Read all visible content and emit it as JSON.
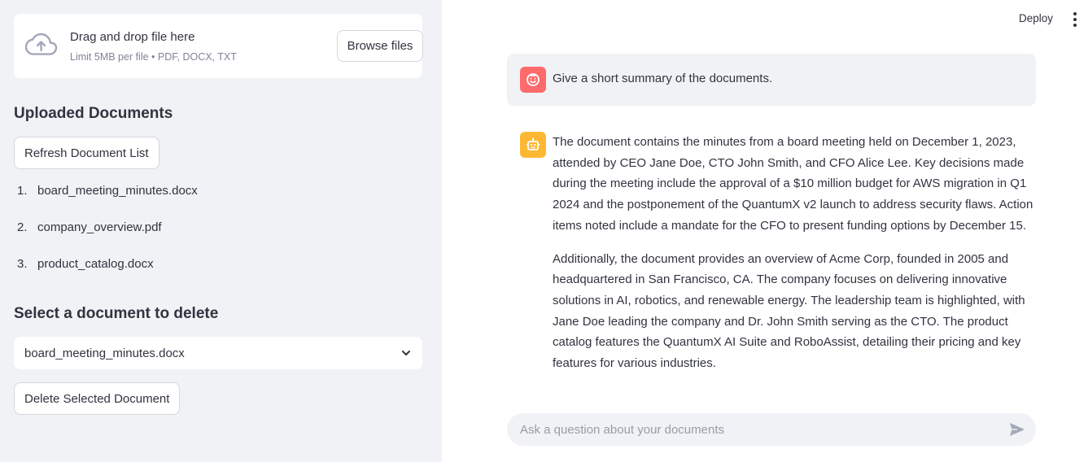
{
  "sidebar": {
    "uploader": {
      "title": "Drag and drop file here",
      "limits": "Limit 5MB per file • PDF, DOCX, TXT",
      "browse_label": "Browse files",
      "icon": "cloud-upload-icon"
    },
    "uploaded_title": "Uploaded Documents",
    "refresh_label": "Refresh Document List",
    "documents": [
      {
        "num": "1.",
        "name": "board_meeting_minutes.docx"
      },
      {
        "num": "2.",
        "name": "company_overview.pdf"
      },
      {
        "num": "3.",
        "name": "product_catalog.docx"
      }
    ],
    "delete_title": "Select a document to delete",
    "select_value": "board_meeting_minutes.docx",
    "delete_label": "Delete Selected Document"
  },
  "header": {
    "deploy_label": "Deploy",
    "menu_icon": "kebab-menu-icon"
  },
  "chat": {
    "user_message": "Give a short summary of the documents.",
    "assistant_paragraphs": [
      "The document contains the minutes from a board meeting held on December 1, 2023, attended by CEO Jane Doe, CTO John Smith, and CFO Alice Lee. Key decisions made during the meeting include the approval of a $10 million budget for AWS migration in Q1 2024 and the postponement of the QuantumX v2 launch to address security flaws. Action items noted include a mandate for the CFO to present funding options by December 15.",
      "Additionally, the document provides an overview of Acme Corp, founded in 2005 and headquartered in San Francisco, CA. The company focuses on delivering innovative solutions in AI, robotics, and renewable energy. The leadership team is highlighted, with Jane Doe leading the company and Dr. John Smith serving as the CTO. The product catalog features the QuantumX AI Suite and RoboAssist, detailing their pricing and key features for various industries."
    ],
    "input_placeholder": "Ask a question about your documents"
  },
  "colors": {
    "sidebar_bg": "#f0f2f6",
    "user_avatar": "#ff6b6b",
    "assistant_avatar": "#fdb833",
    "text": "#31333f"
  }
}
